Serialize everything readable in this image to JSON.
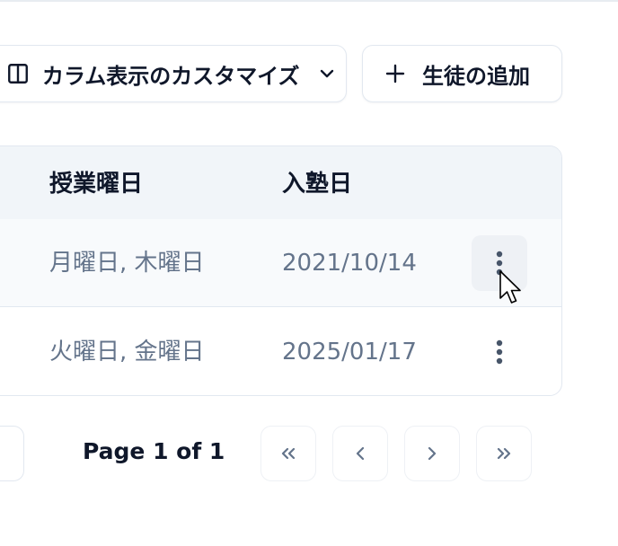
{
  "toolbar": {
    "columns_button": {
      "label": "カラム表示のカスタマイズ",
      "icon": "columns-icon",
      "chevron": "chevron-down-icon"
    },
    "add_button": {
      "label": "生徒の追加",
      "icon": "plus-icon"
    }
  },
  "table": {
    "headers": {
      "days": "授業曜日",
      "join_date": "入塾日"
    },
    "rows": [
      {
        "days": "月曜日, 木曜日",
        "join_date": "2021/10/14",
        "actions_icon": "more-vertical-icon"
      },
      {
        "days": "火曜日, 金曜日",
        "join_date": "2025/01/17",
        "actions_icon": "more-vertical-icon"
      }
    ]
  },
  "pagination": {
    "info": "Page 1 of 1",
    "buttons": [
      "first-page-icon",
      "previous-page-icon",
      "next-page-icon",
      "last-page-icon"
    ]
  },
  "colors": {
    "text": "#0f172a",
    "muted": "#64748b",
    "border": "#e2e8f0",
    "header_bg": "#f1f5f9",
    "icon": "#475569"
  }
}
